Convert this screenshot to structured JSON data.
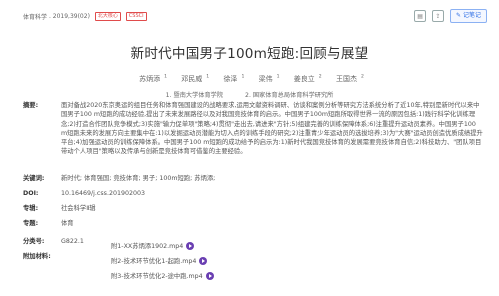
{
  "header": {
    "journal": "体育科学",
    "year_issue": "2019,39(02)",
    "badges": [
      "北大核心",
      "CSSCI"
    ],
    "notes_label": "记笔记"
  },
  "article": {
    "title": "新时代中国男子100m短跑:回顾与展望",
    "authors": [
      {
        "name": "苏炳添",
        "sup": "1"
      },
      {
        "name": "邓民威",
        "sup": "1"
      },
      {
        "name": "徐泽",
        "sup": "1"
      },
      {
        "name": "梁伟",
        "sup": "1"
      },
      {
        "name": "姜良立",
        "sup": "2"
      },
      {
        "name": "王国杰",
        "sup": "2"
      }
    ],
    "affiliations": [
      "1. 暨南大学体育学院",
      "2. 国家体育总局体育科学研究所"
    ]
  },
  "fields": {
    "abstract_label": "摘要:",
    "abstract_text": "面对备战2020东京奥运的组目任务和体育强国建设的战略要求,运用文献资料调研、访谈和案例分析等研究方法系统分析了近10年,特别是新时代以来中国男子100 m短跑的成功经验,提出了未来发展路径以及对我国竞技体育的启示。中国男子100m短跑所取得世界一流的原因包括:1)践行科学化训练理念;2)打造合作团队竞争模式;3)实施\"输力促单项\"策略;4)贯彻\"走出去,请进来\"方针;5)组建完善的训练保障体系;6)注重提升运动员素养。中国男子100 m短跑未来的发展方向主要集中在:1)以发掘运动员潜能为切入点的训练手段的研究;2)注重青少年运动员的选拔培养;3)为\"大赛\"运动员创造优质成绩提升平台;4)加强运动员的训练保障体系。中国男子100 m短跑的成功给予的启示为:1)新时代我国竞技体育的发展需要竞技体育自信;2)科技助力、\"团队项目带动个人项目\"策略以及传承与创新是竞技体育可借鉴的主要经验。",
    "keywords_label": "关键词:",
    "keywords": "新时代; 体育强国; 竞技体育; 男子; 100m短跑; 苏炳添;",
    "doi_label": "DOI:",
    "doi": "10.16469/j.css.201902003",
    "column_label": "专辑:",
    "column": "社会科学Ⅱ辑",
    "subject_label": "专题:",
    "subject": "体育",
    "class_label": "分类号:",
    "class_no": "G822.1",
    "attach_label": "附加材料:",
    "attachments": [
      "附1-XX苏炳添1902.mp4",
      "附2-技术环节优化1-起跑.mp4",
      "附3-技术环节优化2-途中跑.mp4"
    ]
  },
  "colors": {
    "accent": "#2f6fe5",
    "badge": "#e04b4b",
    "play": "#6a3fb2"
  }
}
